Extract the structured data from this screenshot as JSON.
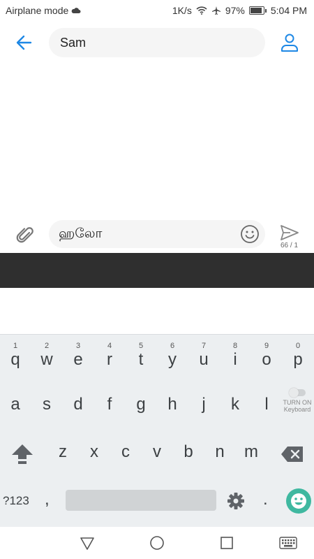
{
  "status_bar": {
    "mode_text": "Airplane mode",
    "speed": "1K/s",
    "battery": "97%",
    "time": "5:04 PM"
  },
  "header": {
    "contact_name": "Sam"
  },
  "compose": {
    "message_text": "ஹலோ",
    "counter": "66 / 1"
  },
  "keyboard": {
    "row1": [
      {
        "hint": "1",
        "char": "q"
      },
      {
        "hint": "2",
        "char": "w"
      },
      {
        "hint": "3",
        "char": "e"
      },
      {
        "hint": "4",
        "char": "r"
      },
      {
        "hint": "5",
        "char": "t"
      },
      {
        "hint": "6",
        "char": "y"
      },
      {
        "hint": "7",
        "char": "u"
      },
      {
        "hint": "8",
        "char": "i"
      },
      {
        "hint": "9",
        "char": "o"
      },
      {
        "hint": "0",
        "char": "p"
      }
    ],
    "row2": [
      "a",
      "s",
      "d",
      "f",
      "g",
      "h",
      "j",
      "k",
      "l"
    ],
    "row3": [
      "z",
      "x",
      "c",
      "v",
      "b",
      "n",
      "m"
    ],
    "turn_on_line1": "TURN ON",
    "turn_on_line2": "Keyboard",
    "num_key": "?123",
    "comma": ",",
    "period": "."
  },
  "colors": {
    "accent": "#1e88e5",
    "keyboard_bg": "#eceff1",
    "dark_band": "#2f2f2f",
    "emoji_fab": "#3fb8a0"
  },
  "icons": [
    "cloud-icon",
    "wifi-icon",
    "airplane-icon",
    "battery-icon",
    "back-arrow-icon",
    "contact-icon",
    "paperclip-icon",
    "emoji-icon",
    "send-icon",
    "shift-icon",
    "backspace-icon",
    "gear-icon",
    "nav-back-icon",
    "nav-home-icon",
    "nav-recent-icon",
    "nav-keyboard-icon"
  ]
}
